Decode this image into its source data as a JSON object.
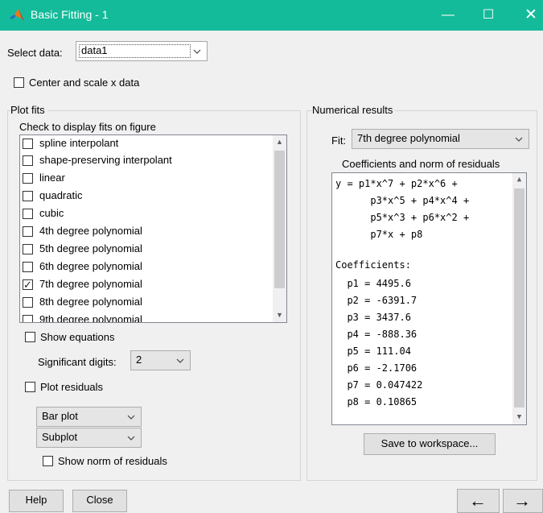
{
  "window": {
    "title": "Basic Fitting - 1",
    "minimize": "—",
    "maximize": "☐",
    "close": "✕",
    "accent": "#14bb9a"
  },
  "select_data": {
    "label": "Select data:",
    "value": "data1"
  },
  "center_scale": {
    "label": "Center and scale x data",
    "checked": false
  },
  "plot_fits": {
    "title": "Plot fits",
    "subtitle": "Check to display fits on figure",
    "items": [
      {
        "label": "spline interpolant",
        "checked": false
      },
      {
        "label": "shape-preserving interpolant",
        "checked": false
      },
      {
        "label": "linear",
        "checked": false
      },
      {
        "label": "quadratic",
        "checked": false
      },
      {
        "label": "cubic",
        "checked": false
      },
      {
        "label": "4th degree polynomial",
        "checked": false
      },
      {
        "label": "5th degree polynomial",
        "checked": false
      },
      {
        "label": "6th degree polynomial",
        "checked": false
      },
      {
        "label": "7th degree polynomial",
        "checked": true
      },
      {
        "label": "8th degree polynomial",
        "checked": false
      },
      {
        "label": "9th degree polynomial",
        "checked": false
      }
    ],
    "show_equations": {
      "label": "Show equations",
      "checked": false
    },
    "significant_digits": {
      "label": "Significant digits:",
      "value": "2"
    },
    "plot_residuals": {
      "label": "Plot residuals",
      "checked": false
    },
    "residual_plot_type": "Bar plot",
    "residual_plot_location": "Subplot",
    "show_norm": {
      "label": "Show norm of residuals",
      "checked": false
    }
  },
  "numerical_results": {
    "title": "Numerical results",
    "fit_label": "Fit:",
    "fit_value": "7th degree polynomial",
    "coeff_header": "Coefficients and norm of residuals",
    "lines": [
      "y = p1*x^7 + p2*x^6 +",
      "      p3*x^5 + p4*x^4 +",
      "      p5*x^3 + p6*x^2 +",
      "      p7*x + p8",
      "",
      "Coefficients:",
      "  p1 = 4495.6",
      "  p2 = -6391.7",
      "  p3 = 3437.6",
      "  p4 = -888.36",
      "  p5 = 111.04",
      "  p6 = -2.1706",
      "  p7 = 0.047422",
      "  p8 = 0.10865"
    ],
    "save_button": "Save to workspace..."
  },
  "footer": {
    "help": "Help",
    "close": "Close",
    "back": "←",
    "forward": "→"
  }
}
